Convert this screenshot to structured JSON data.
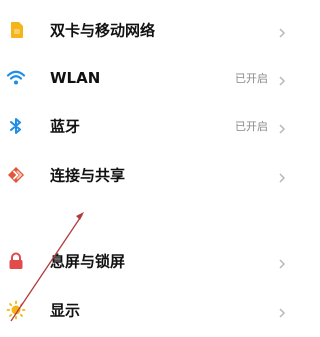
{
  "settings": {
    "items": [
      {
        "label": "双卡与移动网络",
        "status": "",
        "icon": "sim-card-icon"
      },
      {
        "label": "WLAN",
        "status": "已开启",
        "icon": "wifi-icon"
      },
      {
        "label": "蓝牙",
        "status": "已开启",
        "icon": "bluetooth-icon"
      },
      {
        "label": "连接与共享",
        "status": "",
        "icon": "connection-share-icon"
      },
      {
        "label": "息屏与锁屏",
        "status": "",
        "icon": "lock-icon"
      },
      {
        "label": "显示",
        "status": "",
        "icon": "brightness-icon"
      }
    ]
  },
  "colors": {
    "sim": "#f5b41a",
    "wifi": "#1e8ee6",
    "bluetooth": "#1e8ee6",
    "share": "#e2573b",
    "lock": "#e24b4b",
    "display": "#f5b41a",
    "annotation_arrow": "#b23a3a"
  }
}
